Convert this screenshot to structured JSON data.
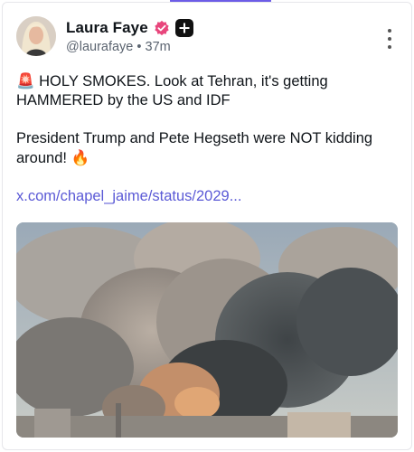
{
  "post": {
    "author_name": "Laura Faye",
    "handle": "@laurafaye",
    "separator": "•",
    "time": "37m",
    "line1_emoji": "🚨",
    "line1": " HOLY SMOKES. Look at Tehran, it's getting HAMMERED by the US and IDF",
    "line2": "President Trump and Pete Hegseth were NOT kidding around! ",
    "line2_emoji": "🔥",
    "link": "x.com/chapel_jaime/status/2029..."
  },
  "icons": {
    "verified": "verified-badge-icon",
    "plus": "plus-badge-icon",
    "more": "more-vertical-icon"
  },
  "colors": {
    "accent": "#6c5ce7",
    "link": "#5b5ad6",
    "verified": "#e8467c"
  }
}
